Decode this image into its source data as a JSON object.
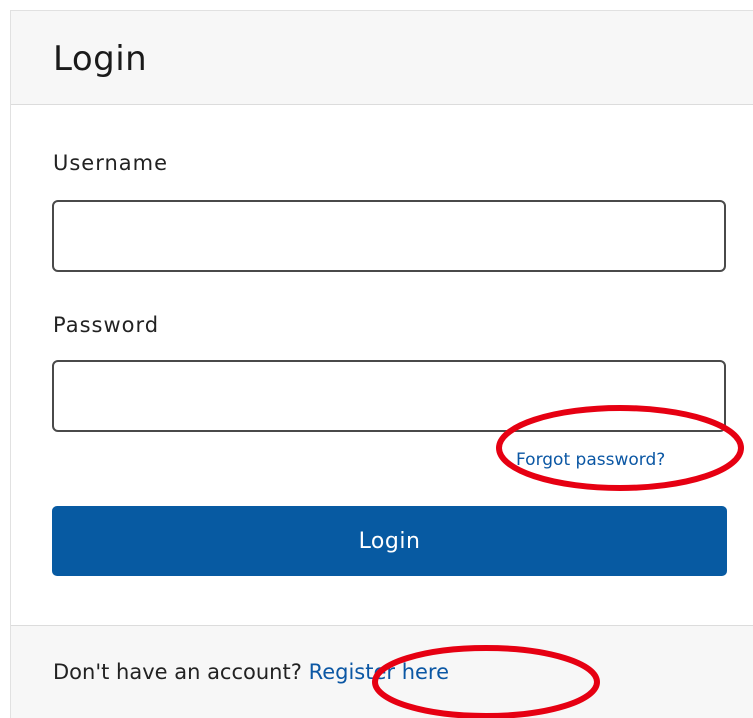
{
  "card": {
    "title": "Login"
  },
  "form": {
    "username_label": "Username",
    "username_value": "",
    "password_label": "Password",
    "password_value": "",
    "forgot_link": "Forgot password?",
    "login_button": "Login"
  },
  "footer": {
    "prompt": "Don't have an account?",
    "register_link": "Register here"
  },
  "colors": {
    "primary": "#075aa2",
    "link": "#0b57a4",
    "annotation": "#e60012",
    "header_bg": "#f7f7f7"
  }
}
